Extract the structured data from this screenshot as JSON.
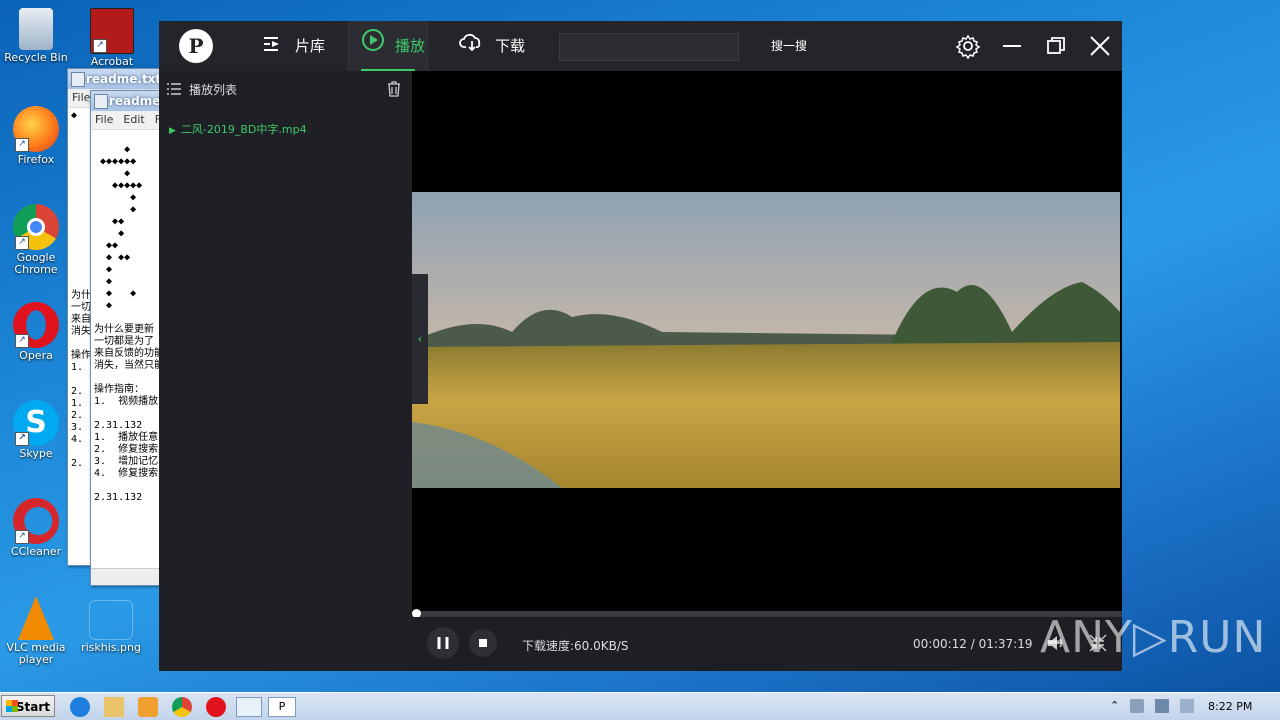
{
  "desktop": {
    "icons": [
      {
        "label": "Recycle Bin"
      },
      {
        "label": "Acrobat"
      },
      {
        "label": "Firefox"
      },
      {
        "label": "Google Chrome"
      },
      {
        "label": "Opera"
      },
      {
        "label": "Skype"
      },
      {
        "label": "CCleaner"
      },
      {
        "label": "VLC media player"
      },
      {
        "label": "riskhis.png"
      }
    ]
  },
  "notepad_back": {
    "title": "readme.txt -",
    "menu": [
      "File"
    ],
    "text": "◆\n\n\n\n\n\n\n\n\n\n\n\n\n\n\n为什\n一切\n来自\n消失\n\n操作\n1.\n\n2.\n1.\n2.\n3.\n4.\n\n2."
  },
  "notepad_front": {
    "title": "readme.",
    "menu": [
      "File",
      "Edit",
      "F"
    ],
    "text": "\n     ◆\n ◆◆◆◆◆◆\n     ◆\n   ◆◆◆◆◆\n      ◆\n      ◆\n   ◆◆\n    ◆\n  ◆◆\n  ◆ ◆◆\n  ◆\n  ◆\n  ◆   ◆\n  ◆\n\n为什么要更新\n一切都是为了\n来自反馈的功能\n消失，当然只能\n\n操作指南：\n1.  视频播放\n\n2.31.132\n1.  播放任意\n2.  修复搜索\n3.  增加记忆\n4.  修复搜索\n\n2.31.132"
  },
  "player": {
    "logo": "P",
    "tabs": [
      {
        "label": "片库",
        "icon": "library-icon"
      },
      {
        "label": "播放",
        "icon": "play-circle-icon",
        "active": true
      },
      {
        "label": "下载",
        "icon": "cloud-download-icon"
      }
    ],
    "search_button": "搜一搜",
    "search_value": "",
    "playlist": {
      "title": "播放列表",
      "items": [
        {
          "name": "二风-2019_BD中字.mp4",
          "playing": true
        }
      ]
    },
    "progress": 0.002,
    "status": {
      "download_speed": "下载速度:60.0KB/S",
      "time": "00:00:12  / 01:37:19"
    },
    "accent": "#3fc96a"
  },
  "watermark": "ANY▷RUN",
  "taskbar": {
    "start": "Start",
    "clock": "8:22 PM"
  }
}
